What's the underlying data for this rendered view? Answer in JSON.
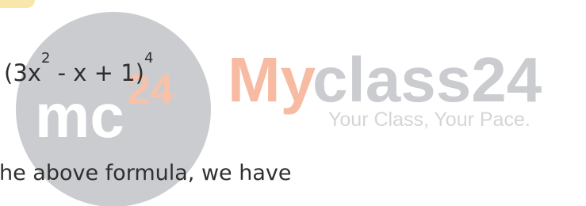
{
  "document": {
    "expression": {
      "base_open": "(3x",
      "inner_exponent": "2",
      "middle": " - x + 1)",
      "outer_exponent": "4"
    },
    "line_text": "he above formula, we have"
  },
  "watermark": {
    "logo_left": "mc",
    "logo_right": "24",
    "brand_left": "My",
    "brand_right": "class24",
    "tagline": "Your Class, Your Pace."
  },
  "colors": {
    "watermark_circle": "#c7c8cc",
    "watermark_orange": "#f5b59b",
    "watermark_gray": "#c8c9ce",
    "text": "#2f2f2f"
  }
}
